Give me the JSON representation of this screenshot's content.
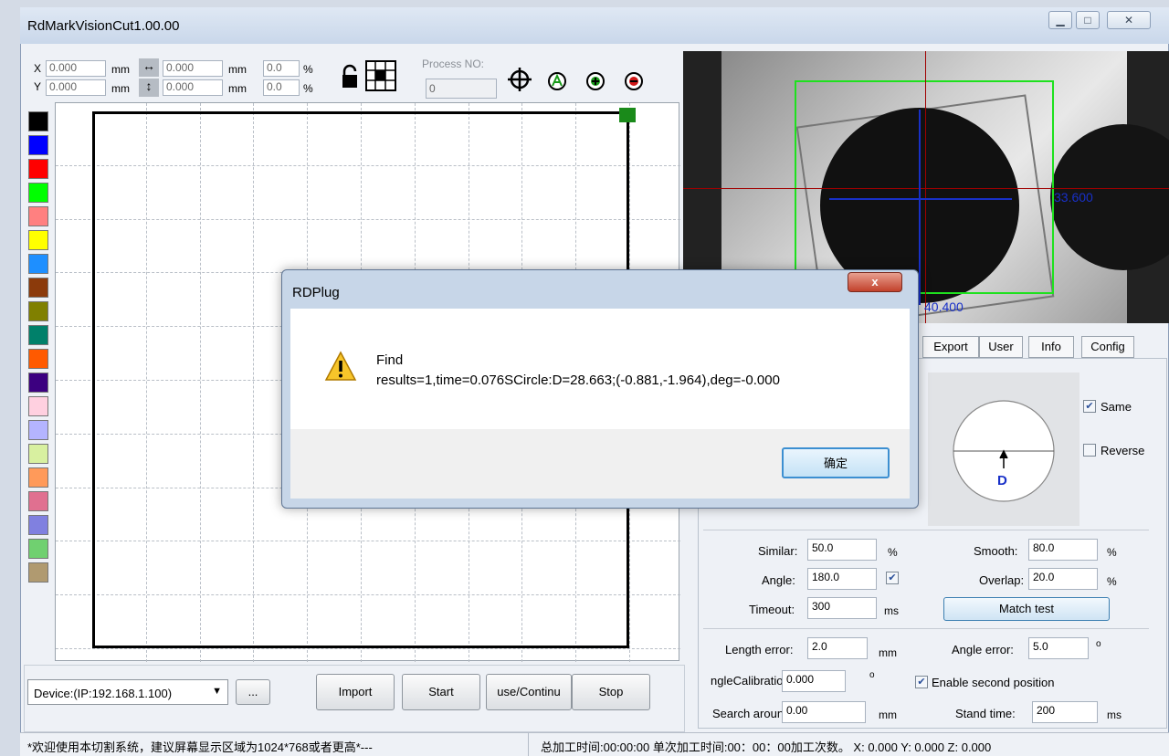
{
  "window": {
    "title": "RdMarkVisionCut1.00.00"
  },
  "toolbar": {
    "x_label": "X",
    "y_label": "Y",
    "x_value": "0.000",
    "y_value": "0.000",
    "w_value": "0.000",
    "h_value": "0.000",
    "unit_mm": "mm",
    "unit_pct": "%",
    "sx_value": "0.0",
    "sy_value": "0.0",
    "process_label": "Process NO:",
    "process_value": "0"
  },
  "palette": [
    "#000000",
    "#0000ff",
    "#ff0000",
    "#00ff00",
    "#ff8080",
    "#ffff00",
    "#1e8fff",
    "#8b3a0b",
    "#808000",
    "#00806a",
    "#ff5a00",
    "#3c0080",
    "#ffd0e0",
    "#b4b4ff",
    "#d8f0a0",
    "#ff9a5a",
    "#e07090",
    "#8080e0",
    "#70d070",
    "#b09a70"
  ],
  "camera": {
    "label_right": "33.600",
    "label_bottom": "40.400"
  },
  "tabs": [
    "Export",
    "User",
    "Info",
    "Config"
  ],
  "match": {
    "same_label": "Same",
    "reverse_label": "Reverse",
    "same_checked": "true",
    "reverse_checked": "false",
    "direction_label": "D",
    "similar_label": "Similar:",
    "similar_value": "50.0",
    "smooth_label": "Smooth:",
    "smooth_value": "80.0",
    "angle_label": "Angle:",
    "angle_value": "180.0",
    "overlap_label": "Overlap:",
    "overlap_value": "20.0",
    "timeout_label": "Timeout:",
    "timeout_value": "300",
    "ms": "ms",
    "match_test": "Match test",
    "length_error_label": "Length error:",
    "length_error_value": "2.0",
    "angle_error_label": "Angle error:",
    "angle_error_value": "5.0",
    "angle_cal_label": "ngleCalibration:",
    "angle_cal_value": "0.000",
    "enable_second_label": "Enable second position",
    "search_label": "Search around:",
    "search_value": "0.00",
    "stand_label": "Stand time:",
    "stand_value": "200",
    "degree": "o",
    "pct": "%",
    "mm": "mm"
  },
  "bottom": {
    "device": "Device:(IP:192.168.1.100)",
    "more": "...",
    "import": "Import",
    "start": "Start",
    "pause": "use/Continu",
    "stop": "Stop"
  },
  "status": {
    "left": "*欢迎使用本切割系统，建议屏幕显示区域为1024*768或者更高*---",
    "right": "总加工时间:00:00:00 单次加工时间:00：00：00加工次数。 X: 0.000   Y: 0.000   Z: 0.000"
  },
  "dialog": {
    "title": "RDPlug",
    "line1": "Find",
    "line2": "results=1,time=0.076SCircle:D=28.663;(-0.881,-1.964),deg=-0.000",
    "ok": "确定"
  }
}
